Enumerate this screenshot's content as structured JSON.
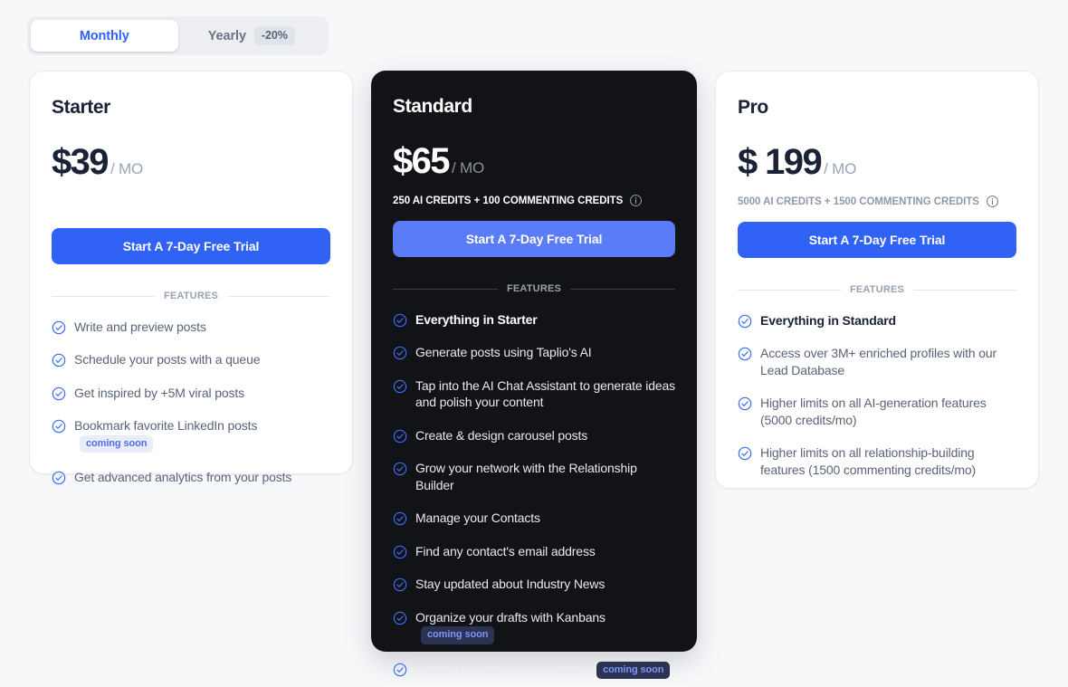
{
  "billing_toggle": {
    "options": [
      {
        "label": "Monthly",
        "active": true,
        "badge": null
      },
      {
        "label": "Yearly",
        "active": false,
        "badge": "-20%"
      }
    ]
  },
  "colors": {
    "page_background": "#f7f8fa",
    "accent_blue": "#2f62f5",
    "accent_blue_light": "#5b7cf7",
    "dark_card": "#121317",
    "badge_background": "#dfe3ea",
    "text_dark": "#1a2235",
    "text_muted": "#5a6478"
  },
  "plans": [
    {
      "id": "starter",
      "name": "Starter",
      "price": "$39",
      "period": "/ MO",
      "credits": null,
      "cta": "Start A 7-Day Free Trial",
      "features_label": "FEATURES",
      "features": [
        {
          "text": "Write and preview posts",
          "bold": false,
          "badge": null
        },
        {
          "text": "Schedule your posts with a queue",
          "bold": false,
          "badge": null
        },
        {
          "text": "Get inspired by +5M viral posts",
          "bold": false,
          "badge": null
        },
        {
          "text": "Bookmark favorite LinkedIn posts",
          "bold": false,
          "badge": "coming soon"
        },
        {
          "text": "Get advanced analytics from your posts",
          "bold": false,
          "badge": null
        }
      ]
    },
    {
      "id": "standard",
      "name": "Standard",
      "price": "$65",
      "period": "/ MO",
      "credits": "250 AI CREDITS + 100 COMMENTING CREDITS",
      "cta": "Start A 7-Day Free Trial",
      "features_label": "FEATURES",
      "features": [
        {
          "text": "Everything in Starter",
          "bold": true,
          "badge": null
        },
        {
          "text": "Generate posts using Taplio's AI",
          "bold": false,
          "badge": null
        },
        {
          "text": "Tap into the AI Chat Assistant to generate ideas and polish your content",
          "bold": false,
          "badge": null
        },
        {
          "text": "Create & design carousel posts",
          "bold": false,
          "badge": null
        },
        {
          "text": "Grow your network with the Relationship Builder",
          "bold": false,
          "badge": null
        },
        {
          "text": "Manage your Contacts",
          "bold": false,
          "badge": null
        },
        {
          "text": "Find any contact's email address",
          "bold": false,
          "badge": null
        },
        {
          "text": "Stay updated about Industry News",
          "bold": false,
          "badge": null
        },
        {
          "text": "Organize your drafts with Kanbans",
          "bold": false,
          "badge": "coming soon"
        },
        {
          "text": "Access premium post templates",
          "bold": false,
          "badge": "coming soon"
        }
      ]
    },
    {
      "id": "pro",
      "name": "Pro",
      "price": "$ 199",
      "period": "/ MO",
      "credits": "5000 AI CREDITS + 1500 COMMENTING CREDITS",
      "cta": "Start A 7-Day Free Trial",
      "features_label": "FEATURES",
      "features": [
        {
          "text": "Everything in Standard",
          "bold": true,
          "badge": null
        },
        {
          "text": "Access over 3M+ enriched profiles with our Lead Database",
          "bold": false,
          "badge": null
        },
        {
          "text": "Higher limits on all AI-generation features (5000 credits/mo)",
          "bold": false,
          "badge": null
        },
        {
          "text": "Higher limits on all relationship-building features (1500 commenting credits/mo)",
          "bold": false,
          "badge": null
        }
      ]
    }
  ]
}
